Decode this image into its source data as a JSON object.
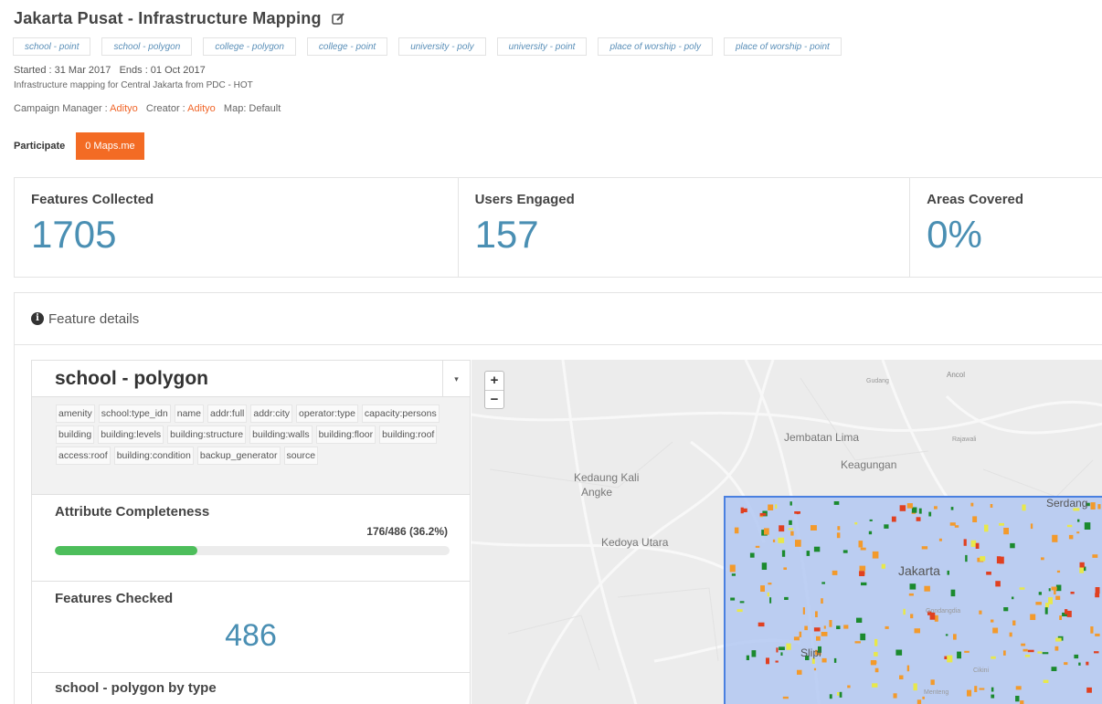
{
  "header": {
    "title": "Jakarta Pusat - Infrastructure Mapping",
    "tags": [
      "school - point",
      "school - polygon",
      "college - polygon",
      "college - point",
      "university - poly",
      "university - point",
      "place of worship - poly",
      "place of worship - point"
    ],
    "dates": "Started : 31 Mar 2017   Ends : 01 Oct 2017",
    "description": "Infrastructure mapping for Central Jakarta from PDC - HOT",
    "manager_label": "Campaign Manager : ",
    "manager": "Adityo",
    "creator_label": "Creator : ",
    "creator": "Adityo",
    "map_label": "Map: Default",
    "participate_label": "Participate",
    "maps_button": "0 Maps.me"
  },
  "stats": [
    {
      "label": "Features Collected",
      "value": "1705"
    },
    {
      "label": "Users Engaged",
      "value": "157"
    },
    {
      "label": "Areas Covered",
      "value": "0%"
    }
  ],
  "details": {
    "title": "Feature details",
    "selected_feature": "school - polygon",
    "attributes": [
      "amenity",
      "school:type_idn",
      "name",
      "addr:full",
      "addr:city",
      "operator:type",
      "capacity:persons",
      "building",
      "building:levels",
      "building:structure",
      "building:walls",
      "building:floor",
      "building:roof",
      "access:roof",
      "building:condition",
      "backup_generator",
      "source"
    ],
    "completeness_title": "Attribute Completeness",
    "completeness_value": "176/486 (36.2%)",
    "completeness_fraction": 0.362,
    "checked_title": "Features Checked",
    "checked_value": "486",
    "bytype_title": "school - polygon by type"
  },
  "map": {
    "zoom_in": "+",
    "zoom_out": "−",
    "labels": [
      "Jembatan Lima",
      "Keagungan",
      "Kedaung Kali",
      "Angke",
      "Kedoya Utara",
      "Jakarta",
      "Serdang",
      "Slipi",
      "Gondangdia",
      "Ancol",
      "Gudang",
      "Rajawali",
      "Cikini",
      "Menteng"
    ],
    "colors": {
      "accent": "#f36b24",
      "stat": "#4a8fb3",
      "progress": "#4dbe5b",
      "area_fill": "#b3c8f2",
      "area_border": "#4a80e0"
    }
  },
  "icons": {
    "edit": "edit-icon",
    "info": "info-icon",
    "caret": "chevron-down-icon"
  }
}
